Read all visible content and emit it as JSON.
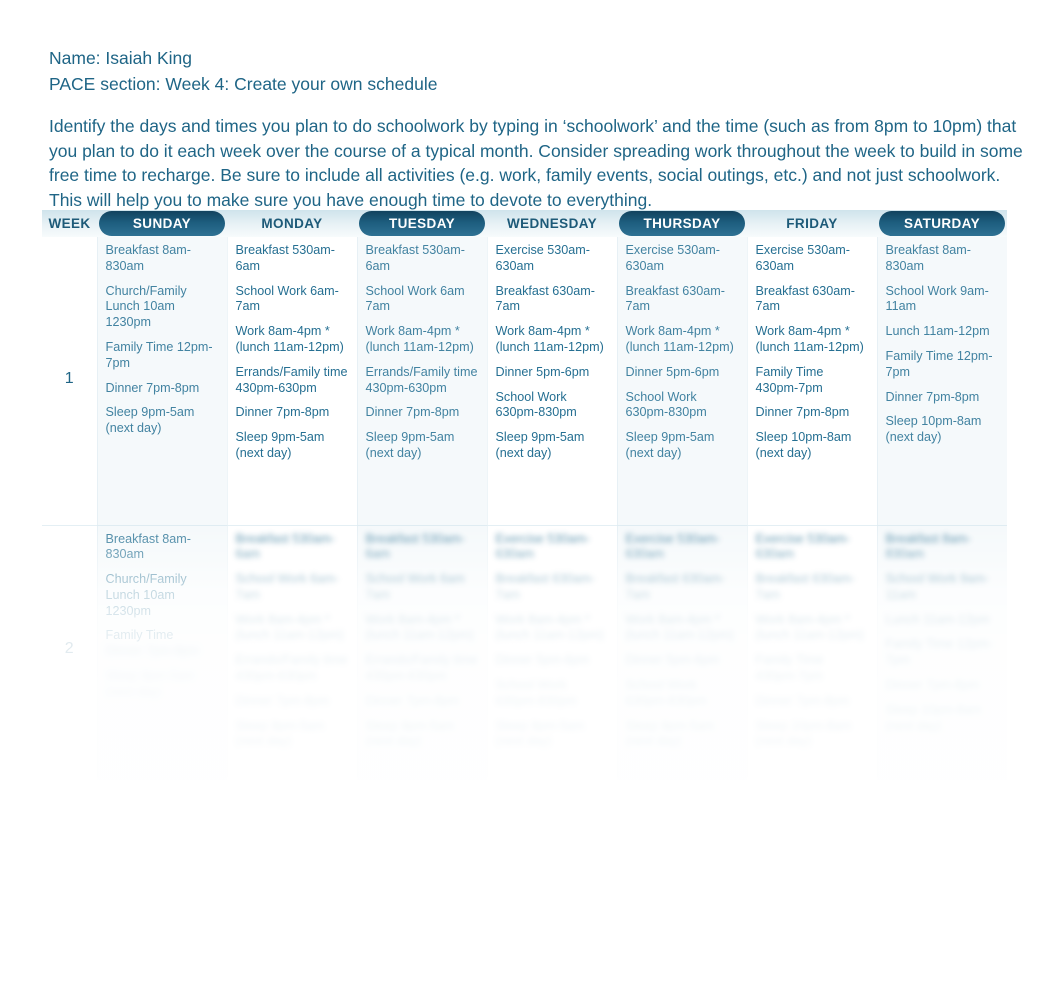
{
  "meta": {
    "name_line": "Name: Isaiah King",
    "pace_line": "PACE section: Week 4: Create your own schedule"
  },
  "intro": {
    "line1": "Identify the days and times you plan to do schoolwork by typing in ‘schoolwork’ and the time (such as from 8pm to 10pm) that",
    "line2": "you plan to do it each week over the course of a typical month. Consider spreading work throughout the week to build in some",
    "line3": "free time to recharge. Be sure to include all activities (e.g. work, family events, social outings, etc.) and not just schoolwork.",
    "line4": "This will help you to make sure you have enough time to devote to everything."
  },
  "table": {
    "headers": {
      "week": "WEEK",
      "sunday": "SUNDAY",
      "monday": "MONDAY",
      "tuesday": "TUESDAY",
      "wednesday": "WEDNESDAY",
      "thursday": "THURSDAY",
      "friday": "FRIDAY",
      "saturday": "SATURDAY"
    },
    "rows": [
      {
        "week": "1",
        "sunday": [
          "Breakfast 8am-830am",
          "Church/Family Lunch 10am 1230pm",
          "Family Time 12pm-7pm",
          "Dinner 7pm-8pm",
          "Sleep 9pm-5am (next day)"
        ],
        "monday": [
          "Breakfast 530am-6am",
          "School Work 6am-7am",
          "Work 8am-4pm *(lunch 11am-12pm)",
          "Errands/Family time 430pm-630pm",
          "Dinner 7pm-8pm",
          "Sleep 9pm-5am (next day)"
        ],
        "tuesday": [
          "Breakfast 530am-6am",
          "School Work 6am 7am",
          "Work 8am-4pm *(lunch 11am-12pm)",
          "Errands/Family time 430pm-630pm",
          "Dinner 7pm-8pm",
          "Sleep 9pm-5am (next day)"
        ],
        "wednesday": [
          "Exercise 530am-630am",
          "Breakfast 630am-7am",
          "Work 8am-4pm *(lunch 11am-12pm)",
          "Dinner 5pm-6pm",
          "School Work 630pm-830pm",
          "Sleep 9pm-5am (next day)"
        ],
        "thursday": [
          "Exercise 530am-630am",
          "Breakfast 630am-7am",
          "Work 8am-4pm *(lunch 11am-12pm)",
          "Dinner 5pm-6pm",
          "School Work 630pm-830pm",
          "Sleep 9pm-5am (next day)"
        ],
        "friday": [
          "Exercise 530am-630am",
          "Breakfast 630am-7am",
          "Work 8am-4pm *(lunch 11am-12pm)",
          "Family Time 430pm-7pm",
          "Dinner 7pm-8pm",
          "Sleep 10pm-8am (next day)"
        ],
        "saturday": [
          "Breakfast 8am-830am",
          "School Work 9am-11am",
          "Lunch 11am-12pm",
          "Family Time 12pm-7pm",
          "Dinner 7pm-8pm",
          "Sleep 10pm-8am (next day)"
        ]
      },
      {
        "week": "2",
        "sunday": [
          "Breakfast 8am-830am",
          "Church/Family Lunch 10am 1230pm",
          "Family Time"
        ],
        "sunday_faded": [
          "Dinner 7pm-8pm",
          "Sleep 9pm-5am (next day)"
        ],
        "monday": [
          "Breakfast 530am-6am",
          "School Work 6am-7am",
          "Work 8am-4pm *(lunch 11am-12pm)",
          "Errands/Family time 430pm-630pm",
          "Dinner 7pm-8pm",
          "Sleep 9pm-5am (next day)"
        ],
        "tuesday": [
          "Breakfast 530am-6am",
          "School Work 6am 7am",
          "Work 8am-4pm *(lunch 11am-12pm)",
          "Errands/Family time 430pm-630pm",
          "Dinner 7pm-8pm",
          "Sleep 9pm-5am (next day)"
        ],
        "wednesday": [
          "Exercise 530am-630am",
          "Breakfast 630am-7am",
          "Work 8am-4pm *(lunch 11am-12pm)",
          "Dinner 5pm-6pm",
          "School Work 630pm-830pm",
          "Sleep 9pm-5am (next day)"
        ],
        "thursday": [
          "Exercise 530am-630am",
          "Breakfast 630am-7am",
          "Work 8am-4pm *(lunch 11am-12pm)",
          "Dinner 5pm-6pm",
          "School Work 630pm-830pm",
          "Sleep 9pm-5am (next day)"
        ],
        "friday": [
          "Exercise 530am-630am",
          "Breakfast 630am-7am",
          "Work 8am-4pm *(lunch 11am-12pm)",
          "Family Time 430pm-7pm",
          "Dinner 7pm-8pm",
          "Sleep 10pm-8am (next day)"
        ],
        "saturday": [
          "Breakfast 8am-830am",
          "School Work 9am-11am",
          "Lunch 11am-12pm",
          "Family Time 12pm-7pm",
          "Dinner 7pm-8pm",
          "Sleep 10pm-8am (next day)"
        ]
      }
    ]
  },
  "colors": {
    "text_blue": "#1f6586",
    "cell_blue": "#256f92",
    "header_pill": "#1d5d7e",
    "header_band": "#cfe3ec"
  }
}
